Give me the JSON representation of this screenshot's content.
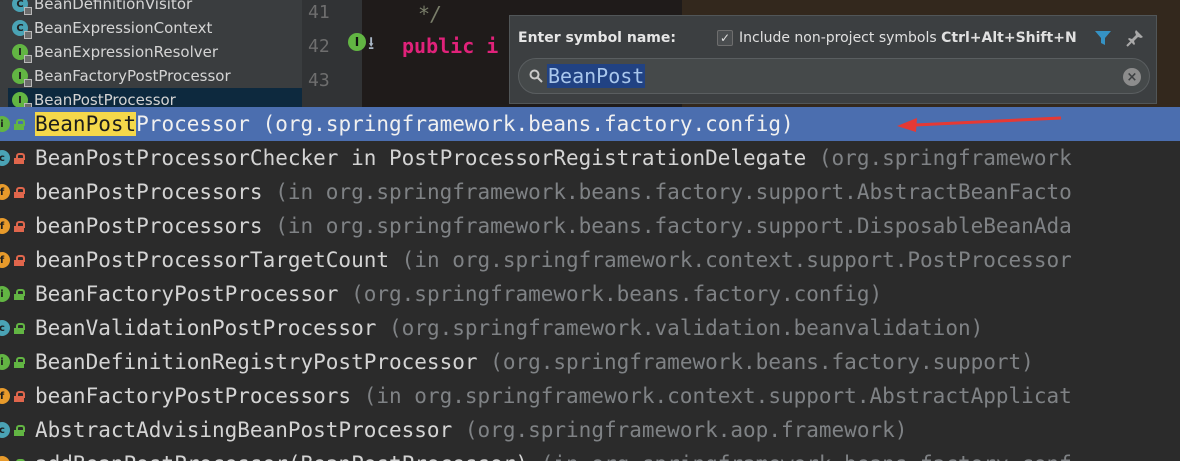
{
  "tree": {
    "items": [
      {
        "label": "BeanDefinitionVisitor",
        "type": "C",
        "selected": false
      },
      {
        "label": "BeanExpressionContext",
        "type": "C",
        "selected": false
      },
      {
        "label": "BeanExpressionResolver",
        "type": "I",
        "selected": false
      },
      {
        "label": "BeanFactoryPostProcessor",
        "type": "I",
        "selected": false
      },
      {
        "label": "BeanPostProcessor",
        "type": "I",
        "selected": true
      }
    ]
  },
  "editor": {
    "line_numbers": [
      "41",
      "42",
      "43"
    ],
    "comment_text": "*/",
    "code_line_42": "public i"
  },
  "popup": {
    "label": "Enter symbol name:",
    "checkbox_label": "Include non-project symbols",
    "checkbox_checked": true,
    "shortcut": "Ctrl+Alt+Shift+N",
    "search_value": "BeanPost"
  },
  "results": [
    {
      "highlight": "BeanPost",
      "rest": "Processor",
      "location": "(org.springframework.beans.factory.config)",
      "icon": "I",
      "vis": "pub",
      "selected": true
    },
    {
      "highlight": "",
      "rest": "BeanPostProcessorChecker in PostProcessorRegistrationDelegate",
      "location": "(org.springframework",
      "icon": "C",
      "vis": "priv",
      "selected": false
    },
    {
      "highlight": "",
      "rest": "beanPostProcessors",
      "location": "(in org.springframework.beans.factory.support.AbstractBeanFacto",
      "icon": "F",
      "vis": "priv",
      "selected": false
    },
    {
      "highlight": "",
      "rest": "beanPostProcessors",
      "location": "(in org.springframework.beans.factory.support.DisposableBeanAda",
      "icon": "F",
      "vis": "priv",
      "selected": false
    },
    {
      "highlight": "",
      "rest": "beanPostProcessorTargetCount",
      "location": "(in org.springframework.context.support.PostProcessor",
      "icon": "F",
      "vis": "priv",
      "selected": false
    },
    {
      "highlight": "",
      "rest": "BeanFactoryPostProcessor",
      "location": "(org.springframework.beans.factory.config)",
      "icon": "I",
      "vis": "pub",
      "selected": false
    },
    {
      "highlight": "",
      "rest": "BeanValidationPostProcessor",
      "location": "(org.springframework.validation.beanvalidation)",
      "icon": "C",
      "vis": "pub",
      "selected": false
    },
    {
      "highlight": "",
      "rest": "BeanDefinitionRegistryPostProcessor",
      "location": "(org.springframework.beans.factory.support)",
      "icon": "I",
      "vis": "pub",
      "selected": false
    },
    {
      "highlight": "",
      "rest": "beanFactoryPostProcessors",
      "location": "(in org.springframework.context.support.AbstractApplicat",
      "icon": "F",
      "vis": "priv",
      "selected": false
    },
    {
      "highlight": "",
      "rest": "AbstractAdvisingBeanPostProcessor",
      "location": "(org.springframework.aop.framework)",
      "icon": "C",
      "vis": "pub",
      "selected": false
    },
    {
      "highlight": "",
      "rest": "addBeanPostProcessor(BeanPostProcessor)",
      "location": "(in org.springframework.beans.factory.conf",
      "icon": "M",
      "vis": "pub",
      "selected": false
    }
  ],
  "colors": {
    "selection": "#4b6eaf",
    "match_highlight": "#f5d84a",
    "annotation_arrow": "#e53935"
  }
}
